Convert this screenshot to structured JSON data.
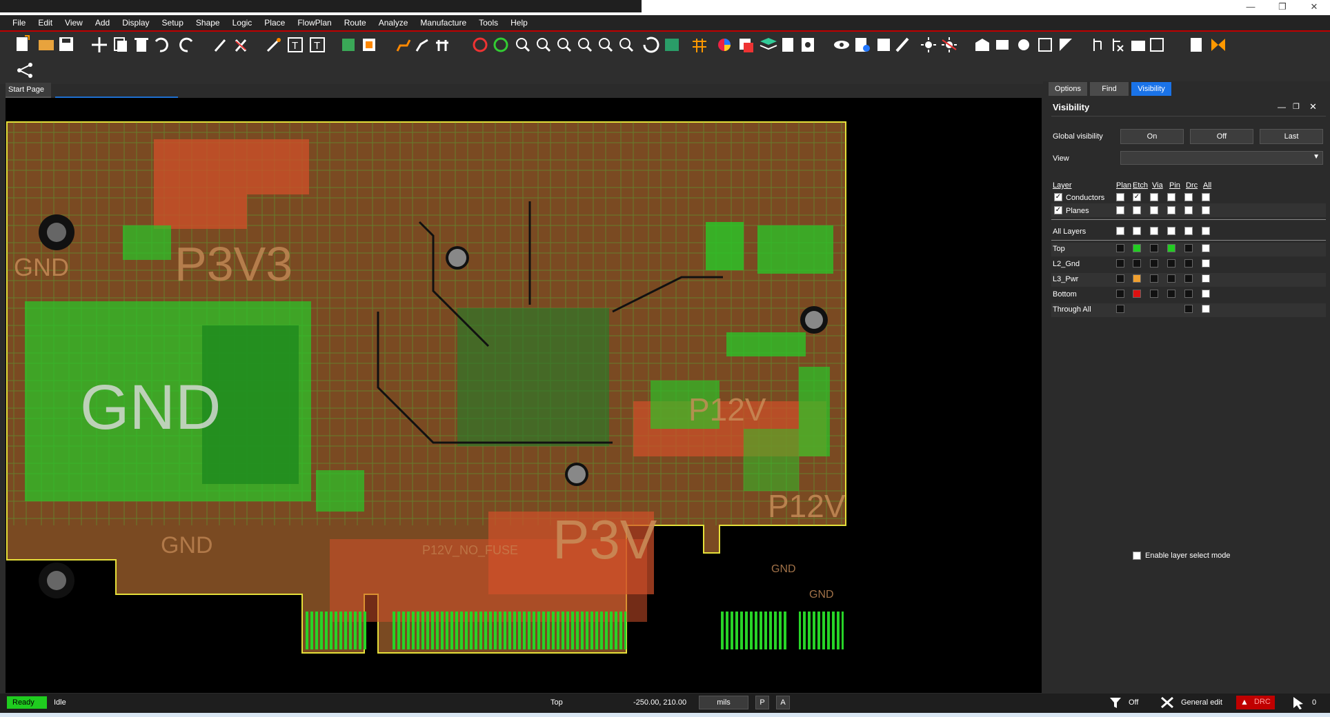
{
  "menu": [
    "File",
    "Edit",
    "View",
    "Add",
    "Display",
    "Setup",
    "Shape",
    "Logic",
    "Place",
    "FlowPlan",
    "Route",
    "Analyze",
    "Manufacture",
    "Tools",
    "Help"
  ],
  "window_controls": {
    "minimize": "—",
    "restore": "❐",
    "close": "✕"
  },
  "doc_tab": "Start Page",
  "panel": {
    "tabs": [
      "Options",
      "Find",
      "Visibility"
    ],
    "active_tab": "Visibility",
    "title": "Visibility",
    "global_visibility_label": "Global visibility",
    "buttons": {
      "on": "On",
      "off": "Off",
      "last": "Last"
    },
    "view_label": "View",
    "view_value": "",
    "columns": [
      "Layer",
      "Plan",
      "Etch",
      "Via",
      "Pin",
      "Drc",
      "All"
    ],
    "categories": [
      {
        "label": "Conductors",
        "checked": true
      },
      {
        "label": "Planes",
        "checked": true
      }
    ],
    "all_layers": "All Layers",
    "layers": [
      {
        "name": "Top",
        "colors": [
          "#111111",
          "#22cc22",
          "#111111",
          "#22cc22",
          "#111111",
          "#ffffff"
        ]
      },
      {
        "name": "L2_Gnd",
        "colors": [
          "#111111",
          "#111111",
          "#111111",
          "#111111",
          "#111111",
          "#ffffff"
        ]
      },
      {
        "name": "L3_Pwr",
        "colors": [
          "#111111",
          "#f0a030",
          "#111111",
          "#111111",
          "#111111",
          "#ffffff"
        ]
      },
      {
        "name": "Bottom",
        "colors": [
          "#111111",
          "#dd1111",
          "#111111",
          "#111111",
          "#111111",
          "#ffffff"
        ]
      },
      {
        "name": "Through All",
        "colors": [
          "#111111",
          "",
          "",
          "",
          "#111111",
          "#ffffff"
        ]
      }
    ],
    "enable_layer_select": "Enable layer select mode"
  },
  "pcb": {
    "labels": [
      "GND",
      "GND",
      "P3V3",
      "P3V",
      "P12V",
      "P12V",
      "GND",
      "GND",
      "GND",
      "P12V_NO_FUSE"
    ]
  },
  "status": {
    "ready": "Ready",
    "state": "Idle",
    "layer": "Top",
    "coords": "-250.00, 210.00",
    "units": "mils",
    "p_button": "P",
    "a_button": "A",
    "filter": "Off",
    "mode": "General edit",
    "drc": "DRC",
    "selected_count": "0"
  },
  "colors": {
    "board": "#7a4a22",
    "copper_top": "#28c828",
    "power_plane": "#d2502a",
    "accent": "#1a73e8"
  }
}
